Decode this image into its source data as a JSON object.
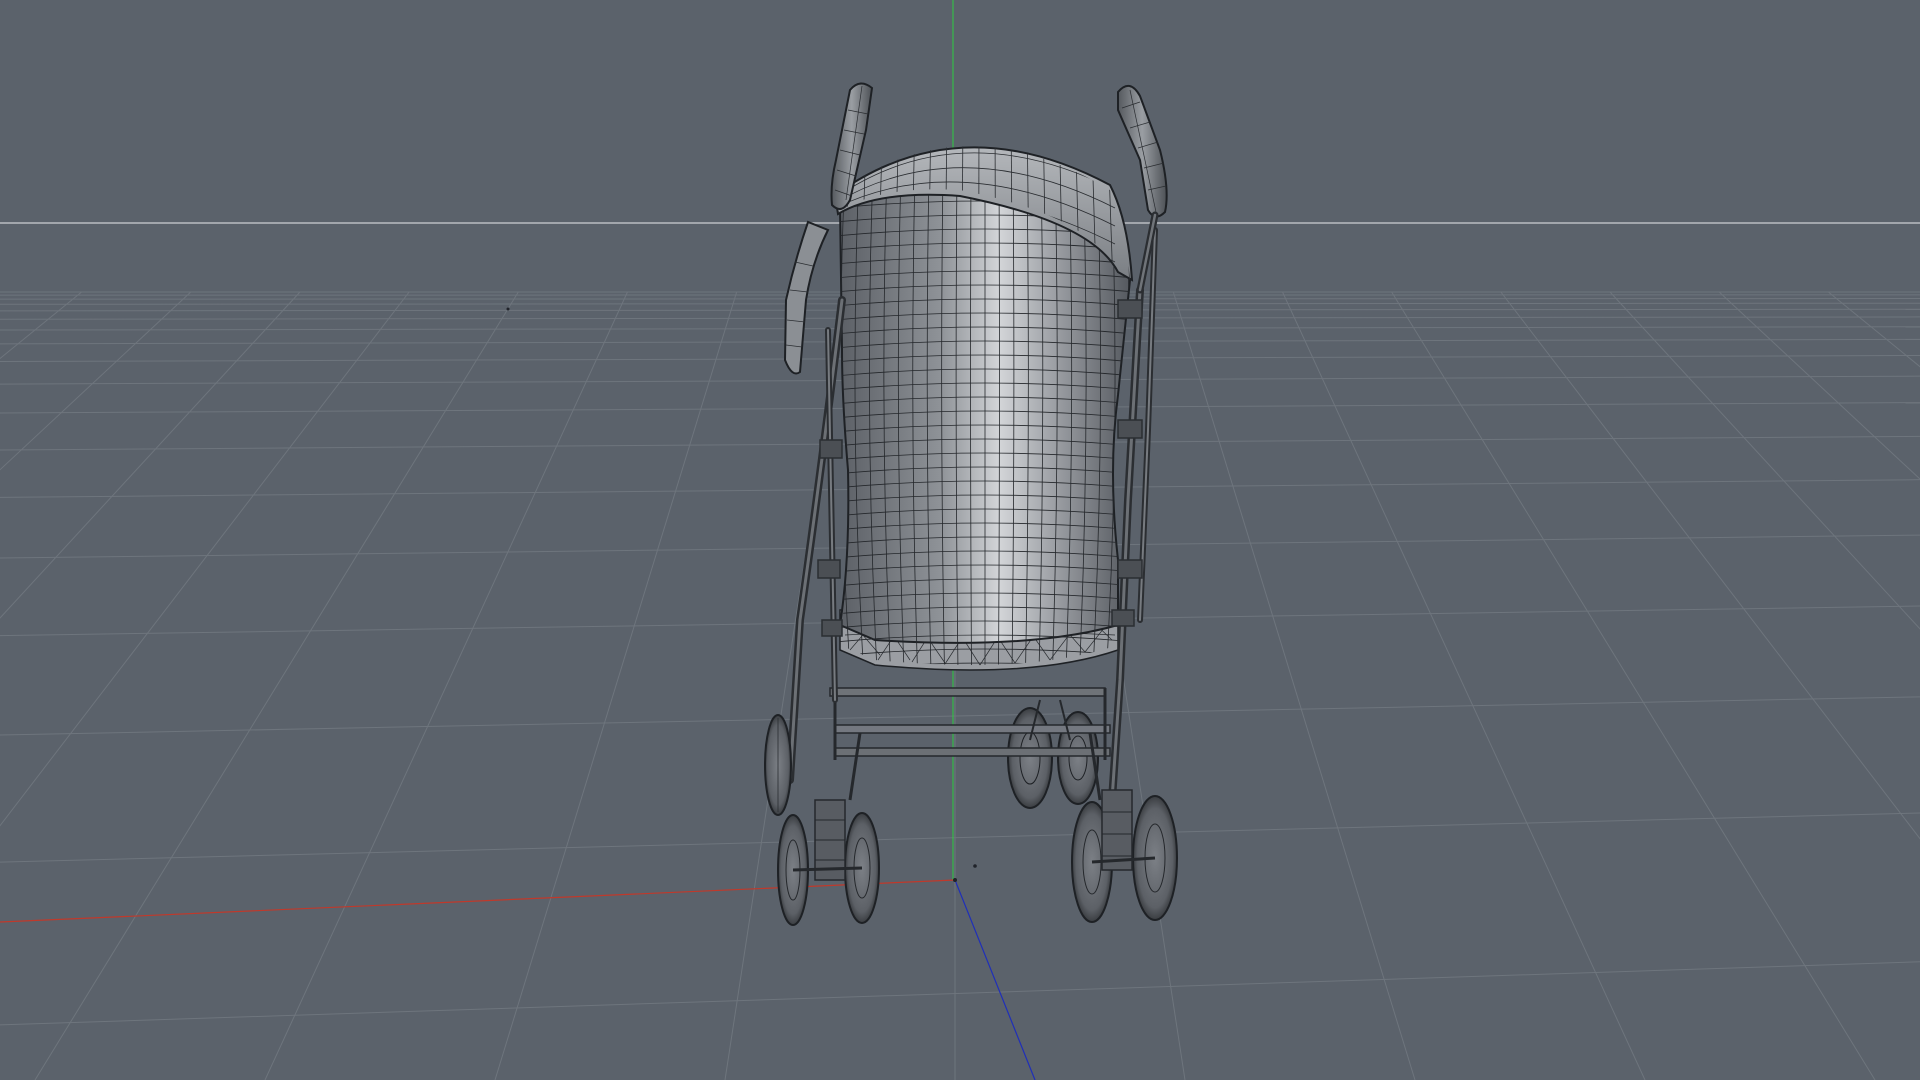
{
  "viewport": {
    "view": "perspective",
    "display_mode": "wireframe-on-shaded",
    "background_color": "#5b626b",
    "grid_color": "#6e757d",
    "horizon_color": "#b9bdc1",
    "axis_x_color": "#c0392b",
    "axis_y_color": "#2ecc40",
    "axis_z_color": "#1f2fb8"
  },
  "model": {
    "object": "baby-stroller",
    "shell_color": "#8d9095",
    "highlight_color": "#d6d8db",
    "wire_color": "#1e2125",
    "frame_color": "#34373b"
  }
}
